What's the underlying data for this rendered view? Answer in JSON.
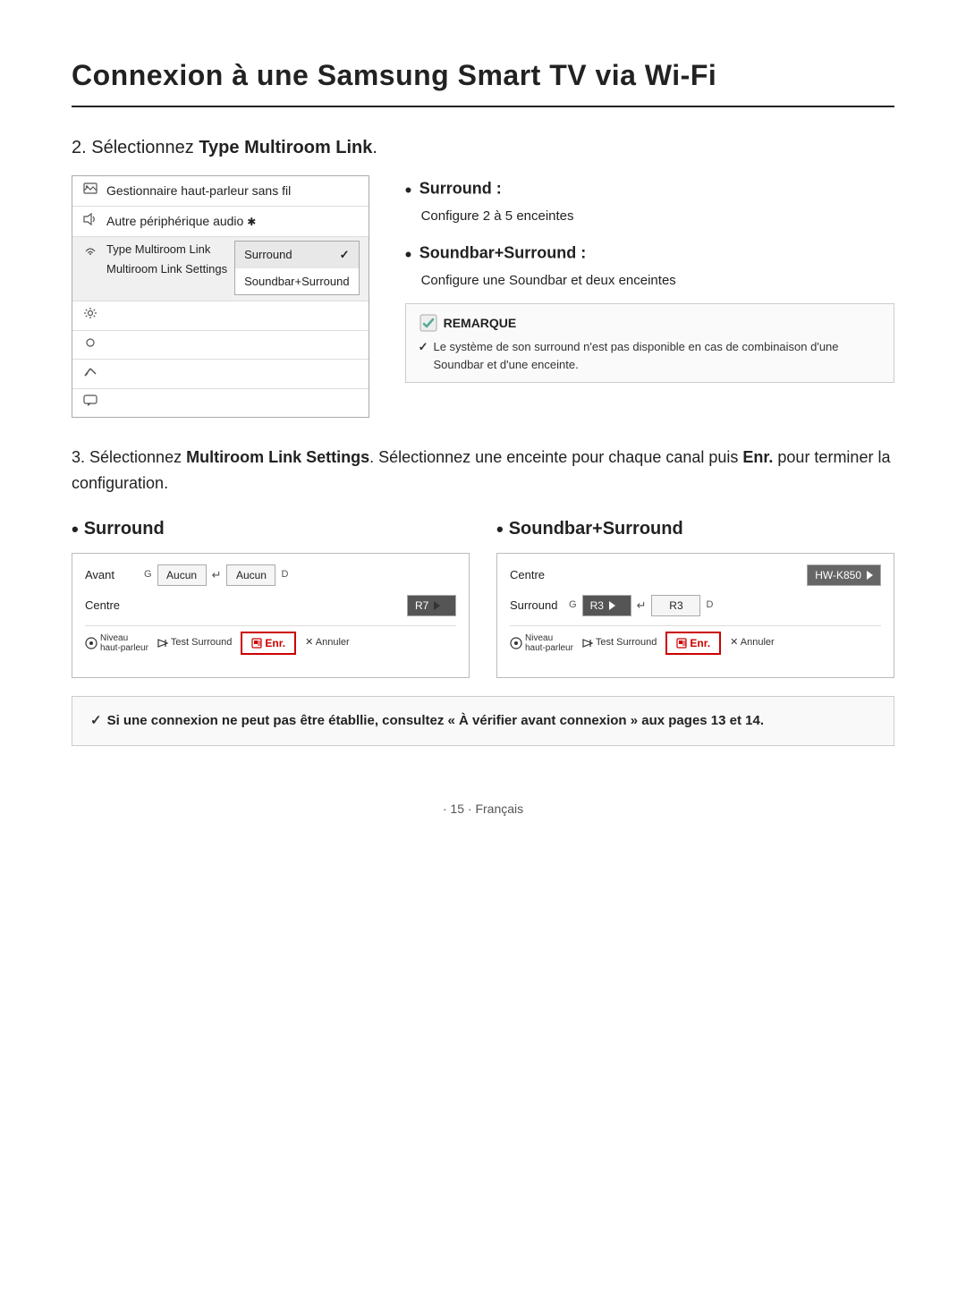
{
  "page": {
    "title": "Connexion à une Samsung Smart TV via Wi-Fi",
    "footer": "· 15 · Français"
  },
  "step2": {
    "header": "2. Sélectionnez ",
    "header_bold": "Type Multiroom Link",
    "header_end": ".",
    "menu": {
      "items": [
        {
          "icon": "image",
          "label": "Gestionnaire haut-parleur sans fil"
        },
        {
          "icon": "sound",
          "label": "Autre périphérique audio"
        },
        {
          "icon": "wireless",
          "label": "Type Multiroom Link",
          "has_submenu": true
        },
        {
          "icon": "settings",
          "label": "Multiroom Link Settings"
        },
        {
          "icon": "circle",
          "label": ""
        },
        {
          "icon": "tools",
          "label": ""
        },
        {
          "icon": "chat",
          "label": ""
        }
      ],
      "submenu": {
        "option1": "Surround",
        "option1_check": "✓",
        "option2": "Soundbar+Surround"
      }
    },
    "bullets": {
      "surround_title": "Surround :",
      "surround_text": "Configure 2 à 5 enceintes",
      "soundbar_title": "Soundbar+Surround :",
      "soundbar_text": "Configure une Soundbar et deux enceintes"
    },
    "note": {
      "title": "REMARQUE",
      "text": "Le système de son surround n'est pas disponible en cas de combinaison d'une Soundbar et d'une enceinte."
    }
  },
  "step3": {
    "header_start": "3. Sélectionnez ",
    "header_bold1": "Multiroom Link Settings",
    "header_mid": ". Sélectionnez une enceinte pour chaque canal puis ",
    "header_bold2": "Enr.",
    "header_end": " pour terminer la configuration.",
    "surround": {
      "title": "Surround",
      "rows": [
        {
          "label": "Avant",
          "side_g": "G",
          "val_g": "Aucun",
          "arrow": "↵",
          "val_d": "Aucun",
          "side_d": "D"
        },
        {
          "label": "Centre",
          "val": "R7",
          "triangle": true
        }
      ],
      "footer": {
        "niveau": "Niveau haut-parleur",
        "test": "Test Surround",
        "enr": "Enr.",
        "annuler": "Annuler"
      }
    },
    "soundbar": {
      "title": "Soundbar+Surround",
      "rows": [
        {
          "label": "Centre",
          "val": "HW-K850",
          "triangle": true
        },
        {
          "label": "Surround",
          "side_g": "G",
          "val_g": "R3",
          "triangle_g": true,
          "arrow": "↵",
          "val_d": "R3",
          "side_d": "D"
        }
      ],
      "footer": {
        "niveau": "Niveau haut-parleur",
        "test": "Test Surround",
        "enr": "Enr.",
        "annuler": "Annuler"
      }
    }
  },
  "final_note": {
    "text_start": "Si une connexion ne peut pas être établlie, consultez «",
    "text_bold": " À vérifier avant connexion",
    "text_end": " » aux pages 13 et 14."
  },
  "labels": {
    "bullet_dot": "•",
    "check": "✓",
    "x": "X"
  }
}
